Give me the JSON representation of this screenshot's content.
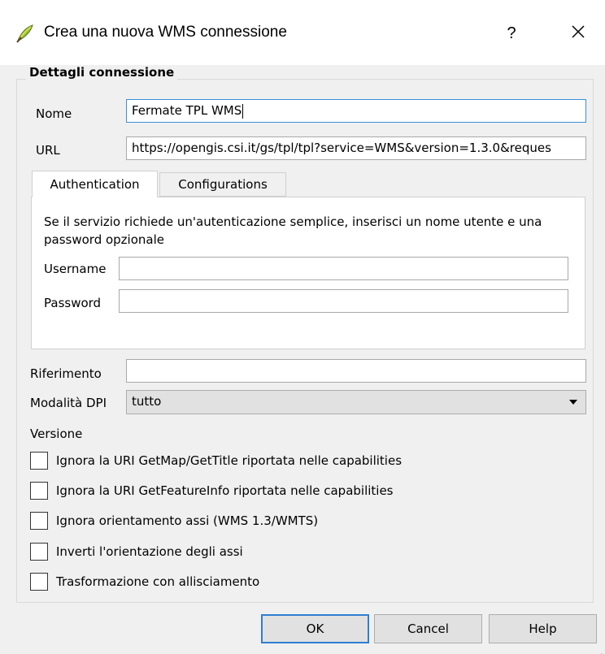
{
  "window": {
    "title": "Crea una nuova WMS connessione",
    "help_label": "?",
    "close_icon": "close-icon",
    "app_icon": "qgis-icon"
  },
  "group": {
    "title": "Dettagli connessione"
  },
  "fields": {
    "name_label": "Nome",
    "name_value": "Fermate TPL WMS",
    "url_label": "URL",
    "url_value": "https://opengis.csi.it/gs/tpl/tpl?service=WMS&version=1.3.0&reques"
  },
  "tabs": [
    {
      "label": "Authentication",
      "active": true
    },
    {
      "label": "Configurations",
      "active": false
    }
  ],
  "auth": {
    "description": "Se il servizio richiede un'autenticazione semplice, inserisci un nome utente e una password opzionale",
    "username_label": "Username",
    "username_value": "",
    "password_label": "Password",
    "password_value": ""
  },
  "referer": {
    "label": "Riferimento",
    "value": ""
  },
  "dpi": {
    "label": "Modalità DPI",
    "selected": "tutto"
  },
  "version": {
    "label": "Versione"
  },
  "checkboxes": [
    {
      "label": "Ignora la URI GetMap/GetTitle riportata nelle capabilities",
      "checked": false
    },
    {
      "label": "Ignora la URI GetFeatureInfo riportata nelle capabilities",
      "checked": false
    },
    {
      "label": "Ignora orientamento assi (WMS 1.3/WMTS)",
      "checked": false
    },
    {
      "label": "Inverti l'orientazione degli assi",
      "checked": false
    },
    {
      "label": "Trasformazione con allisciamento",
      "checked": false
    }
  ],
  "buttons": {
    "ok": "OK",
    "cancel": "Cancel",
    "help": "Help"
  },
  "colors": {
    "focus_border": "#3c8fd8",
    "default_button_border": "#2f7fd2",
    "dialog_bg": "#f0f0f0"
  }
}
